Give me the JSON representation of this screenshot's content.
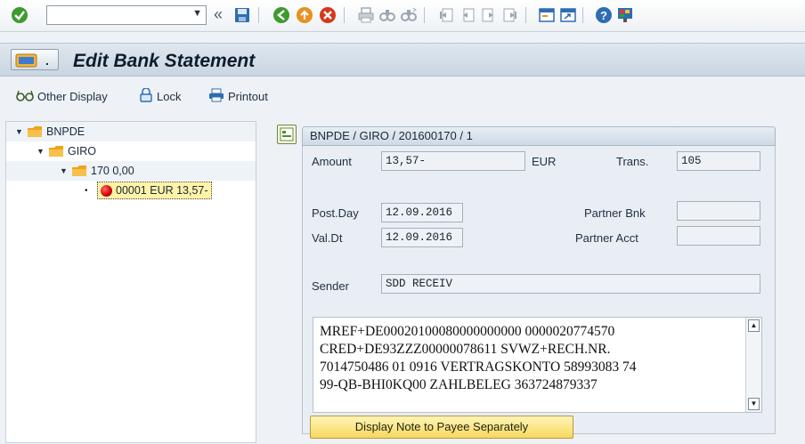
{
  "toolbar": {
    "command_value": "",
    "icons": [
      "enter-icon",
      "back-icon",
      "exit-icon",
      "cancel-icon",
      "print-icon",
      "find-icon",
      "find-next-icon",
      "first-page-icon",
      "previous-page-icon",
      "next-page-icon",
      "last-page-icon",
      "create-session-icon",
      "shortcut-icon",
      "help-icon",
      "customize-layout-icon"
    ]
  },
  "title": {
    "text": "Edit Bank Statement"
  },
  "app_toolbar": {
    "other_display": "Other Display",
    "lock": "Lock",
    "printout": "Printout"
  },
  "tree": {
    "nodes": [
      "BNPDE",
      "GIRO",
      "170 0,00",
      "00001 EUR 13,57-"
    ]
  },
  "detail": {
    "header": "BNPDE / GIRO / 201600170 / 1",
    "amount_label": "Amount",
    "amount_value": "13,57-",
    "currency": "EUR",
    "trans_label": "Trans.",
    "trans_value": "105",
    "post_day_label": "Post.Day",
    "post_day_value": "12.09.2016",
    "val_dt_label": "Val.Dt",
    "val_dt_value": "12.09.2016",
    "partner_bnk_label": "Partner Bnk",
    "partner_bnk_value": "",
    "partner_acct_label": "Partner Acct",
    "partner_acct_value": "",
    "sender_label": "Sender",
    "sender_value": "SDD RECEIV",
    "note_text": "MREF+DE00020100080000000000 0000020774570\nCRED+DE93ZZZ00000078611 SVWZ+RECH.NR.\n7014750486 01 0916 VERTRAGSKONTO 58993083 74\n99-QB-BHI0KQ00 ZAHLBELEG 363724879337",
    "payee_button": "Display Note to Payee Separately"
  },
  "colors": {
    "accent_green": "#3f9b2f",
    "alert_red": "#d00000",
    "folder_orange": "#f0a21a",
    "highlight_yellow": "#f7d85e"
  }
}
